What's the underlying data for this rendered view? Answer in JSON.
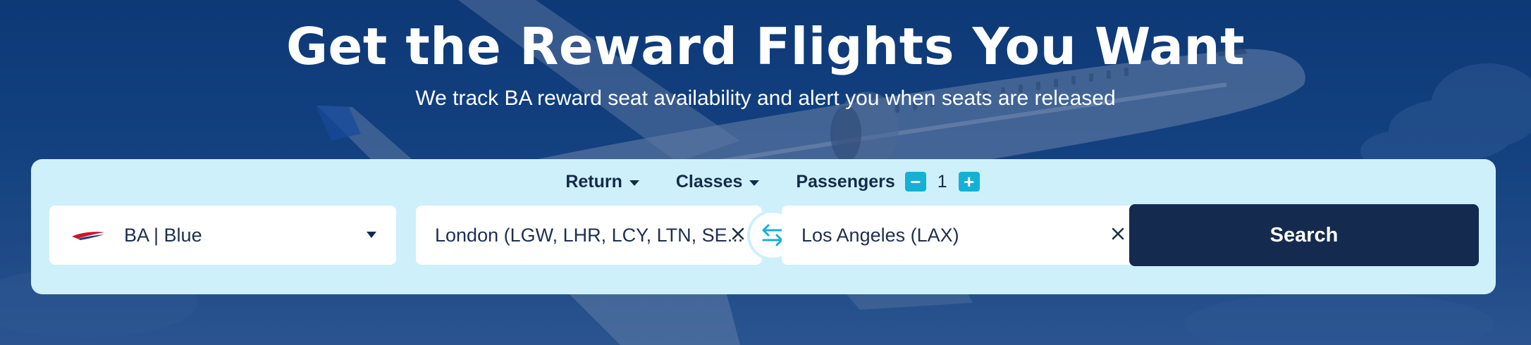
{
  "hero": {
    "title": "Get the Reward Flights You Want",
    "subtitle": "We track BA reward seat availability and alert you when seats are released"
  },
  "options": {
    "trip_type": "Return",
    "classes": "Classes",
    "passengers_label": "Passengers",
    "passengers_minus": "−",
    "passengers_count": "1",
    "passengers_plus": "+"
  },
  "airline": {
    "value": "BA | Blue",
    "logo": "british-airways-speedmarque-icon"
  },
  "origin": {
    "value": "London (LGW, LHR, LCY, LTN, SE..."
  },
  "destination": {
    "value": "Los Angeles (LAX)"
  },
  "search": {
    "label": "Search"
  },
  "colors": {
    "panel_bg": "#cdf0fb",
    "accent": "#14b1d6",
    "dark_navy": "#142a4f",
    "hero_bg": "#174a8c"
  },
  "icons": [
    "caret-down-icon",
    "minus-icon",
    "plus-icon",
    "clear-icon",
    "swap-icon"
  ]
}
